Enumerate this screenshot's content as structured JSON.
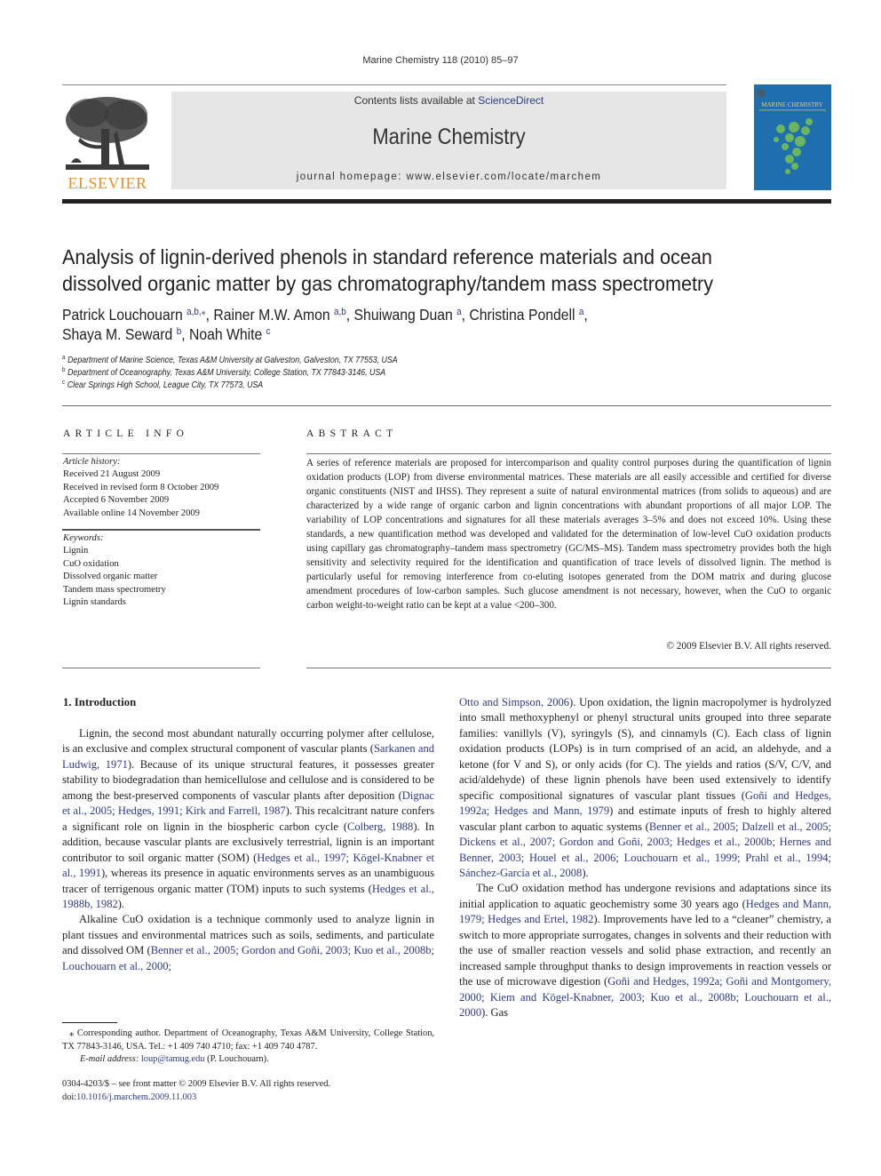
{
  "running_head": "Marine Chemistry 118 (2010) 85–97",
  "masthead": {
    "publisher_logo_text": "ELSEVIER",
    "contents_prefix": "Contents lists available at ",
    "contents_link": "ScienceDirect",
    "journal_title": "Marine Chemistry",
    "homepage_prefix": "journal homepage: ",
    "homepage_url": "www.elsevier.com/locate/marchem",
    "cover_title": "MARINE CHEMISTRY"
  },
  "colors": {
    "link": "#2e3a8c",
    "elsevier_orange": "#e8902b",
    "masthead_gray": "#e6e6e6",
    "cover_blue": "#1f6fae"
  },
  "article": {
    "title_line1": "Analysis of lignin-derived phenols in standard reference materials and ocean",
    "title_line2": "dissolved organic matter by gas chromatography/tandem mass spectrometry",
    "authors": [
      {
        "name": "Patrick Louchouarn",
        "affil": "a,b,",
        "corresponding": "⁎",
        "sep": ", "
      },
      {
        "name": "Rainer M.W. Amon",
        "affil": "a,b",
        "sep": ", "
      },
      {
        "name": "Shuiwang Duan",
        "affil": "a",
        "sep": ", "
      },
      {
        "name": "Christina Pondell",
        "affil": "a",
        "sep": ","
      },
      {
        "name": "Shaya M. Seward",
        "affil": "b",
        "sep": ", "
      },
      {
        "name": "Noah White",
        "affil": "c",
        "sep": ""
      }
    ],
    "affiliations": [
      {
        "mark": "a",
        "text": "Department of Marine Science, Texas A&M University at Galveston, Galveston, TX 77553, USA"
      },
      {
        "mark": "b",
        "text": "Department of Oceanography, Texas A&M University, College Station, TX 77843-3146, USA"
      },
      {
        "mark": "c",
        "text": "Clear Springs High School, League City, TX 77573, USA"
      }
    ]
  },
  "article_info": {
    "heading": "ARTICLE INFO",
    "history_label": "Article history:",
    "history": [
      "Received 21 August 2009",
      "Received in revised form 8 October 2009",
      "Accepted 6 November 2009",
      "Available online 14 November 2009"
    ],
    "keywords_label": "Keywords:",
    "keywords": [
      "Lignin",
      "CuO oxidation",
      "Dissolved organic matter",
      "Tandem mass spectrometry",
      "Lignin standards"
    ]
  },
  "abstract": {
    "heading": "ABSTRACT",
    "text": "A series of reference materials are proposed for intercomparison and quality control purposes during the quantification of lignin oxidation products (LOP) from diverse environmental matrices. These materials are all easily accessible and certified for diverse organic constituents (NIST and IHSS). They represent a suite of natural environmental matrices (from solids to aqueous) and are characterized by a wide range of organic carbon and lignin concentrations with abundant proportions of all major LOP. The variability of LOP concentrations and signatures for all these materials averages 3–5% and does not exceed 10%. Using these standards, a new quantification method was developed and validated for the determination of low-level CuO oxidation products using capillary gas chromatography–tandem mass spectrometry (GC/MS–MS). Tandem mass spectrometry provides both the high sensitivity and selectivity required for the identification and quantification of trace levels of dissolved lignin. The method is particularly useful for removing interference from co-eluting isotopes generated from the DOM matrix and during glucose amendment procedures of low-carbon samples. Such glucose amendment is not necessary, however, when the CuO to organic carbon weight-to-weight ratio can be kept at a value <200–300.",
    "copyright": "© 2009 Elsevier B.V. All rights reserved."
  },
  "introduction": {
    "heading": "1. Introduction",
    "p1": [
      {
        "t": "Lignin, the second most abundant naturally occurring polymer after cellulose, is an exclusive and complex structural component of vascular plants ("
      },
      {
        "t": "Sarkanen and Ludwig, 1971",
        "link": true
      },
      {
        "t": "). Because of its unique structural features, it possesses greater stability to biodegradation than hemicellulose and cellulose and is considered to be among the best-preserved components of vascular plants after deposition ("
      },
      {
        "t": "Dignac et al., 2005; Hedges, 1991; Kirk and Farrell, 1987",
        "link": true
      },
      {
        "t": "). This recalcitrant nature confers a significant role on lignin in the biospheric carbon cycle ("
      },
      {
        "t": "Colberg, 1988",
        "link": true
      },
      {
        "t": "). In addition, because vascular plants are exclusively terrestrial, lignin is an important contributor to soil organic matter (SOM) ("
      },
      {
        "t": "Hedges et al., 1997; Kögel-Knabner et al., 1991",
        "link": true
      },
      {
        "t": "), whereas its presence in aquatic environments serves as an unambiguous tracer of terrigenous organic matter (TOM) inputs to such systems ("
      },
      {
        "t": "Hedges et al., 1988b, 1982",
        "link": true
      },
      {
        "t": ")."
      }
    ],
    "p2": [
      {
        "t": "Alkaline CuO oxidation is a technique commonly used to analyze lignin in plant tissues and environmental matrices such as soils, sediments, and particulate and dissolved OM ("
      },
      {
        "t": "Benner et al., 2005; Gordon and Goñi, 2003; Kuo et al., 2008b; Louchouarn et al., 2000;",
        "link": true
      }
    ],
    "p2_cont": [
      {
        "t": "Otto and Simpson, 2006",
        "link": true
      },
      {
        "t": "). Upon oxidation, the lignin macropolymer is hydrolyzed into small methoxyphenyl or phenyl structural units grouped into three separate families: vanillyls (V), syringyls (S), and cinnamyls (C). Each class of lignin oxidation products (LOPs) is in turn comprised of an acid, an aldehyde, and a ketone (for V and S), or only acids (for C). The yields and ratios (S/V, C/V, and acid/aldehyde) of these lignin phenols have been used extensively to identify specific compositional signatures of vascular plant tissues ("
      },
      {
        "t": "Goñi and Hedges, 1992a; Hedges and Mann, 1979",
        "link": true
      },
      {
        "t": ") and estimate inputs of fresh to highly altered vascular plant carbon to aquatic systems ("
      },
      {
        "t": "Benner et al., 2005; Dalzell et al., 2005; Dickens et al., 2007; Gordon and Goñi, 2003; Hedges et al., 2000b; Hernes and Benner, 2003; Houel et al., 2006; Louchouarn et al., 1999; Prahl et al., 1994; Sánchez-García et al., 2008",
        "link": true
      },
      {
        "t": ")."
      }
    ],
    "p3": [
      {
        "t": "The CuO oxidation method has undergone revisions and adaptations since its initial application to aquatic geochemistry some 30 years ago ("
      },
      {
        "t": "Hedges and Mann, 1979; Hedges and Ertel, 1982",
        "link": true
      },
      {
        "t": "). Improvements have led to a “cleaner” chemistry, a switch to more appropriate surrogates, changes in solvents and their reduction with the use of smaller reaction vessels and solid phase extraction, and recently an increased sample throughput thanks to design improvements in reaction vessels or the use of microwave digestion ("
      },
      {
        "t": "Goñi and Hedges, 1992a; Goñi and Montgomery, 2000; Kiem and Kögel-Knabner, 2003; Kuo et al., 2008b; Louchouarn et al., 2000",
        "link": true
      },
      {
        "t": "). Gas"
      }
    ]
  },
  "footnote": {
    "corresponding": "⁎ Corresponding author. Department of Oceanography, Texas A&M University, College Station, TX 77843-3146, USA. Tel.: +1 409 740 4710; fax: +1 409 740 4787.",
    "email_label": "E-mail address: ",
    "email": "loup@tamug.edu",
    "email_suffix": " (P. Louchouarn)."
  },
  "front_matter": {
    "issn_line": "0304-4203/$ – see front matter © 2009 Elsevier B.V. All rights reserved.",
    "doi_prefix": "doi:",
    "doi": "10.1016/j.marchem.2009.11.003"
  }
}
